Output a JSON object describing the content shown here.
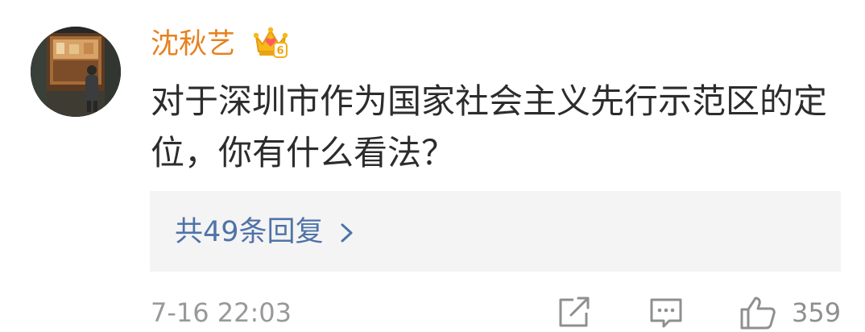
{
  "comment": {
    "username": "沈秋艺",
    "vip_badge_text": "6",
    "text": "对于深圳市作为国家社会主义先行示范区的定位，你有什么看法？",
    "replies_label": "共49条回复",
    "timestamp": "7-16 22:03",
    "like_count": "359"
  },
  "colors": {
    "username": "#e8811e",
    "link": "#4f73a8",
    "muted": "#999999",
    "replies_background": "#f4f4f4"
  },
  "icons": {
    "avatar": "avatar-photo",
    "badge": "crown-icon",
    "replies": "chevron-right-icon",
    "share": "share-edit-icon",
    "reply": "comment-icon",
    "like": "thumbs-up-icon"
  }
}
